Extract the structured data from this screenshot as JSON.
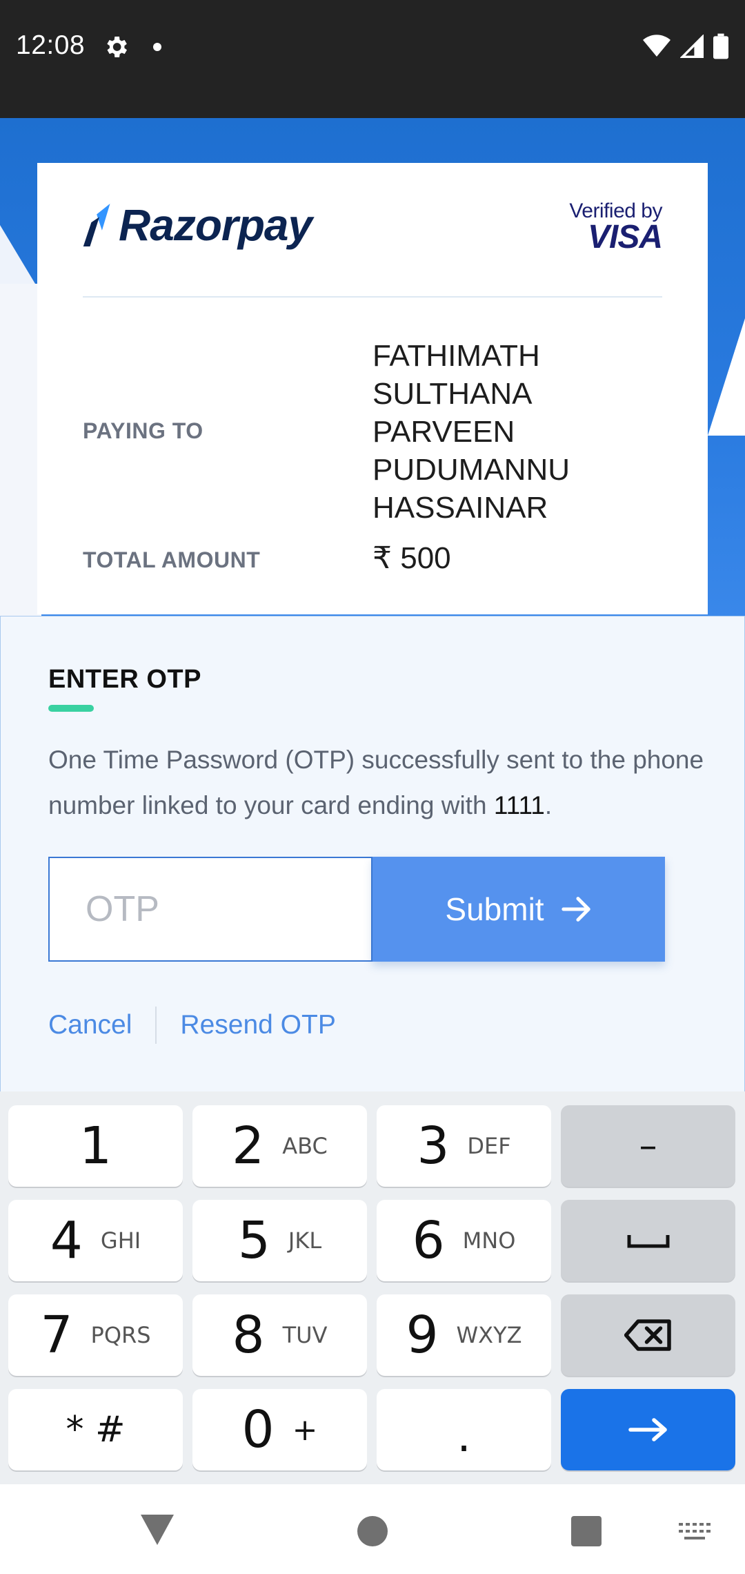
{
  "status_bar": {
    "time": "12:08",
    "icons": [
      "settings-icon",
      "notification-dot-icon",
      "wifi-icon",
      "signal-icon",
      "battery-icon"
    ]
  },
  "header": {
    "brand": "Razorpay",
    "badge_line1": "Verified by",
    "badge_line2": "VISA"
  },
  "payment": {
    "paying_to_label": "PAYING TO",
    "paying_to_lines": [
      "FATHIMATH",
      "SULTHANA",
      "PARVEEN",
      "PUDUMANNU",
      "HASSAINAR"
    ],
    "total_amount_label": "TOTAL AMOUNT",
    "total_amount_value": "₹ 500"
  },
  "otp": {
    "title": "ENTER OTP",
    "message_prefix": "One Time Password (OTP) successfully sent to the phone number linked to your card ending with ",
    "card_last_digits": "1111",
    "message_suffix": ".",
    "input_placeholder": "OTP",
    "submit_label": "Submit",
    "cancel_label": "Cancel",
    "resend_label": "Resend OTP"
  },
  "keyboard": {
    "keys": [
      {
        "main": "1",
        "sub": ""
      },
      {
        "main": "2",
        "sub": "ABC"
      },
      {
        "main": "3",
        "sub": "DEF"
      },
      {
        "main": "–",
        "sub": ""
      },
      {
        "main": "4",
        "sub": "GHI"
      },
      {
        "main": "5",
        "sub": "JKL"
      },
      {
        "main": "6",
        "sub": "MNO"
      },
      {
        "main": "space-icon",
        "sub": ""
      },
      {
        "main": "7",
        "sub": "PQRS"
      },
      {
        "main": "8",
        "sub": "TUV"
      },
      {
        "main": "9",
        "sub": "WXYZ"
      },
      {
        "main": "backspace-icon",
        "sub": ""
      },
      {
        "main": "* #",
        "sub": ""
      },
      {
        "main": "0",
        "sub": "+"
      },
      {
        "main": ".",
        "sub": ""
      },
      {
        "main": "arrow-right-icon",
        "sub": ""
      }
    ]
  },
  "colors": {
    "hero_blue": "#1e6fd0",
    "submit_blue": "#5592ee",
    "link_blue": "#4b8ae4",
    "accent_green": "#39d1a1",
    "action_key_blue": "#1a73e8"
  }
}
